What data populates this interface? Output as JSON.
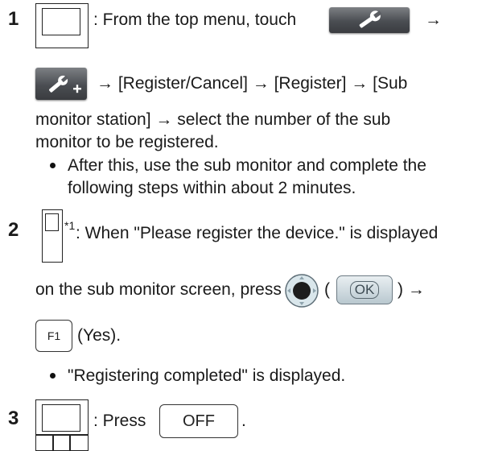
{
  "steps": [
    {
      "number": "1",
      "lines": [
        ": From the top menu, touch",
        "→",
        "→ [Register/Cancel] → [Register] → [Sub",
        "monitor station] → select the number of the sub",
        "monitor to be registered."
      ],
      "notes": [
        "After this, use the sub monitor and complete the",
        "following steps within about 2 minutes."
      ]
    },
    {
      "number": "2",
      "footnote": "*1",
      "lines": [
        ": When \"Please register the device.\" is displayed",
        "on the sub monitor screen, press",
        "(",
        ") →",
        "(Yes)."
      ],
      "ok_label": "OK",
      "f1_label": "F1",
      "notes": [
        "\"Registering completed\" is displayed."
      ]
    },
    {
      "number": "3",
      "lines": [
        ": Press",
        "."
      ],
      "off_label": "OFF"
    }
  ],
  "icons": {
    "main_monitor": "main-monitor-device-icon",
    "settings": "wrench-icon",
    "settings_add": "wrench-plus-icon",
    "sub_monitor": "sub-monitor-device-icon",
    "joystick": "joystick-center-button-icon"
  },
  "colors": {
    "dark_button": "#4a4d52",
    "ok_button": "#b9c8cf",
    "text": "#1a1a1a"
  }
}
